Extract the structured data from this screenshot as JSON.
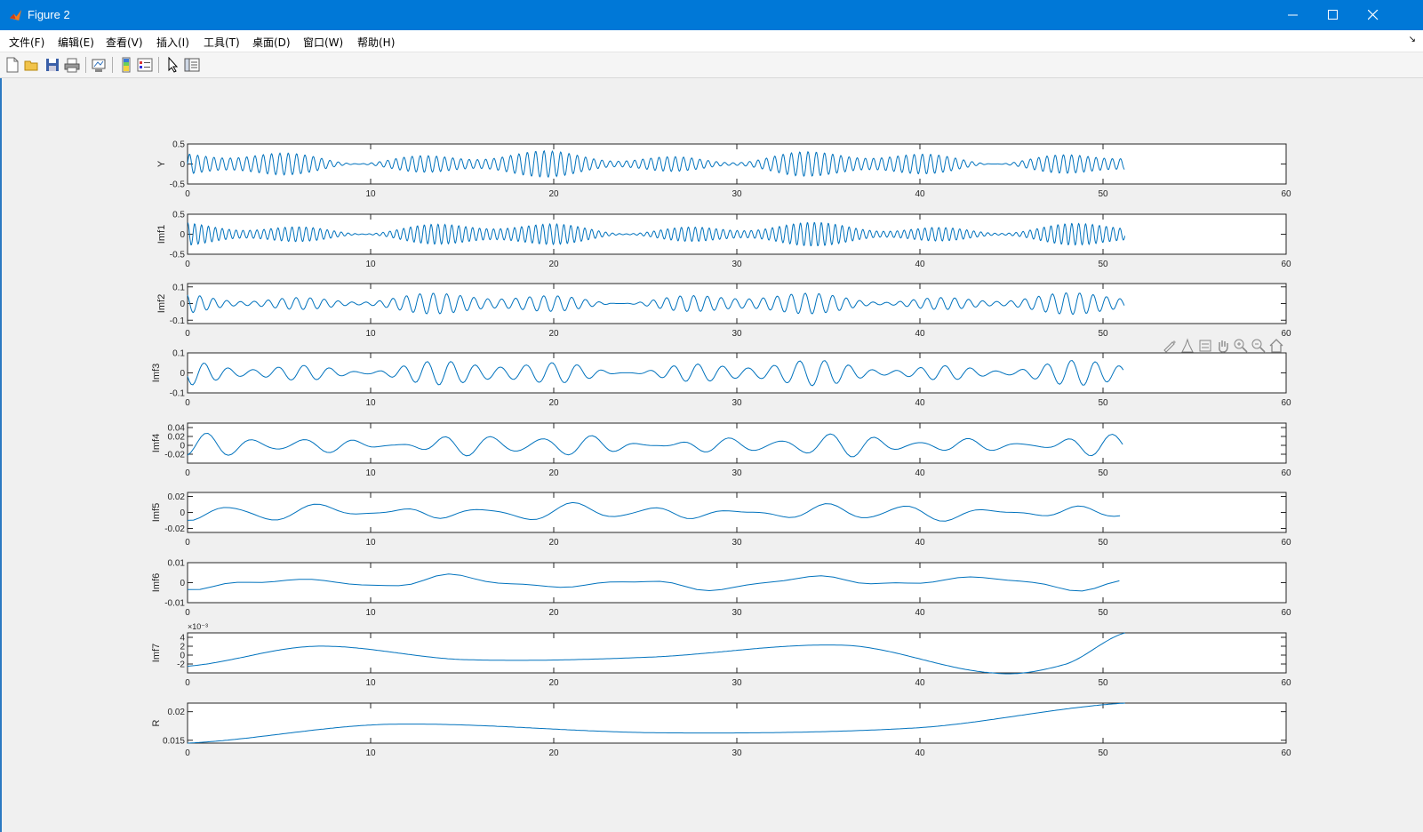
{
  "window": {
    "title": "Figure 2",
    "accent": "#0078d7",
    "controls": [
      "minimize-icon",
      "maximize-icon",
      "close-icon"
    ]
  },
  "menu": [
    "文件(F)",
    "编辑(E)",
    "查看(V)",
    "插入(I)",
    "工具(T)",
    "桌面(D)",
    "窗口(W)",
    "帮助(H)"
  ],
  "toolbar": [
    "new-figure-icon",
    "open-file-icon",
    "save-icon",
    "print-icon",
    "link-plot-icon",
    "colorbar-icon",
    "legend-icon",
    "edit-plot-icon",
    "property-inspector-icon"
  ],
  "axes_toolbar": [
    "brush-icon",
    "data-cursor-icon",
    "rotate-icon",
    "pan-icon",
    "zoom-in-icon",
    "zoom-out-icon",
    "home-icon"
  ],
  "chart_data": [
    {
      "type": "line",
      "ylabel": "Y",
      "xlim": [
        0,
        60
      ],
      "ylim": [
        -0.5,
        0.5
      ],
      "yticks": [
        "0.5",
        "0",
        "-0.5"
      ],
      "ytick_values": [
        0.5,
        0,
        -0.5
      ],
      "xticks": [
        "0",
        "10",
        "20",
        "30",
        "40",
        "50",
        "60"
      ],
      "signal": {
        "x_end": 51.2,
        "amplitude": 0.3,
        "period": 0.45,
        "envelope": "modulated"
      },
      "color": "#0072bd"
    },
    {
      "type": "line",
      "ylabel": "Imf1",
      "xlim": [
        0,
        60
      ],
      "ylim": [
        -0.5,
        0.5
      ],
      "yticks": [
        "0.5",
        "0",
        "-0.5"
      ],
      "ytick_values": [
        0.5,
        0,
        -0.5
      ],
      "xticks": [
        "0",
        "10",
        "20",
        "30",
        "40",
        "50",
        "60"
      ],
      "signal": {
        "x_end": 51.2,
        "amplitude": 0.27,
        "period": 0.38,
        "envelope": "modulated"
      },
      "color": "#0072bd"
    },
    {
      "type": "line",
      "ylabel": "Imf2",
      "xlim": [
        0,
        60
      ],
      "ylim": [
        -0.12,
        0.12
      ],
      "yticks": [
        "0.1",
        "0",
        "-0.1"
      ],
      "ytick_values": [
        0.1,
        0,
        -0.1
      ],
      "xticks": [
        "0",
        "10",
        "20",
        "30",
        "40",
        "50",
        "60"
      ],
      "signal": {
        "x_end": 51.2,
        "amplitude": 0.06,
        "period": 0.75,
        "envelope": "modulated"
      },
      "color": "#0072bd"
    },
    {
      "type": "line",
      "ylabel": "Imf3",
      "xlim": [
        0,
        60
      ],
      "ylim": [
        -0.1,
        0.1
      ],
      "yticks": [
        "0.1",
        "0",
        "-0.1"
      ],
      "ytick_values": [
        0.1,
        0,
        -0.1
      ],
      "xticks": [
        "0",
        "10",
        "20",
        "30",
        "40",
        "50",
        "60"
      ],
      "signal": {
        "x_end": 51.2,
        "amplitude": 0.06,
        "period": 1.35,
        "envelope": "modulated"
      },
      "color": "#0072bd"
    },
    {
      "type": "line",
      "ylabel": "Imf4",
      "xlim": [
        0,
        60
      ],
      "ylim": [
        -0.04,
        0.05
      ],
      "yticks": [
        "0.04",
        "0.02",
        "0",
        "-0.02"
      ],
      "ytick_values": [
        0.04,
        0.02,
        0,
        -0.02
      ],
      "xticks": [
        "0",
        "10",
        "20",
        "30",
        "40",
        "50",
        "60"
      ],
      "signal": {
        "x_end": 51.2,
        "amplitude": 0.025,
        "period": 2.6,
        "envelope": "modulated"
      },
      "color": "#0072bd"
    },
    {
      "type": "line",
      "ylabel": "Imf5",
      "xlim": [
        0,
        60
      ],
      "ylim": [
        -0.025,
        0.025
      ],
      "yticks": [
        "0.02",
        "0",
        "-0.02"
      ],
      "ytick_values": [
        0.02,
        0,
        -0.02
      ],
      "xticks": [
        "0",
        "10",
        "20",
        "30",
        "40",
        "50",
        "60"
      ],
      "signal": {
        "x_end": 51.2,
        "amplitude": 0.012,
        "period": 4.6,
        "envelope": "modulated"
      },
      "color": "#0072bd"
    },
    {
      "type": "line",
      "ylabel": "Imf6",
      "xlim": [
        0,
        60
      ],
      "ylim": [
        -0.01,
        0.01
      ],
      "yticks": [
        "0.01",
        "0",
        "-0.01"
      ],
      "ytick_values": [
        0.01,
        0,
        -0.01
      ],
      "xticks": [
        "0",
        "10",
        "20",
        "30",
        "40",
        "50",
        "60"
      ],
      "signal": {
        "x_end": 51.2,
        "amplitude": 0.004,
        "period": 9.5,
        "envelope": "modulated"
      },
      "color": "#0072bd"
    },
    {
      "type": "line",
      "ylabel": "Imf7",
      "exponent_label": "×10⁻³",
      "xlim": [
        0,
        60
      ],
      "ylim": [
        -4,
        5
      ],
      "yticks": [
        "4",
        "2",
        "0",
        "-2"
      ],
      "ytick_values": [
        4,
        2,
        0,
        -2
      ],
      "xticks": [
        "0",
        "10",
        "20",
        "30",
        "40",
        "50",
        "60"
      ],
      "points": [
        [
          0,
          -2.5
        ],
        [
          7,
          2
        ],
        [
          15,
          -1
        ],
        [
          25,
          -0.5
        ],
        [
          36,
          2.2
        ],
        [
          44,
          -4
        ],
        [
          48,
          -2
        ],
        [
          51.2,
          5
        ]
      ],
      "color": "#0072bd"
    },
    {
      "type": "line",
      "ylabel": "R",
      "xlim": [
        0,
        60
      ],
      "ylim": [
        0.0145,
        0.0215
      ],
      "yticks": [
        "0.02",
        "0.015"
      ],
      "ytick_values": [
        0.02,
        0.015
      ],
      "xticks": [
        "0",
        "10",
        "20",
        "30",
        "40",
        "50",
        "60"
      ],
      "points": [
        [
          0,
          0.0145
        ],
        [
          11,
          0.0178
        ],
        [
          26,
          0.0163
        ],
        [
          40,
          0.0172
        ],
        [
          51.2,
          0.0215
        ]
      ],
      "color": "#0072bd"
    }
  ]
}
